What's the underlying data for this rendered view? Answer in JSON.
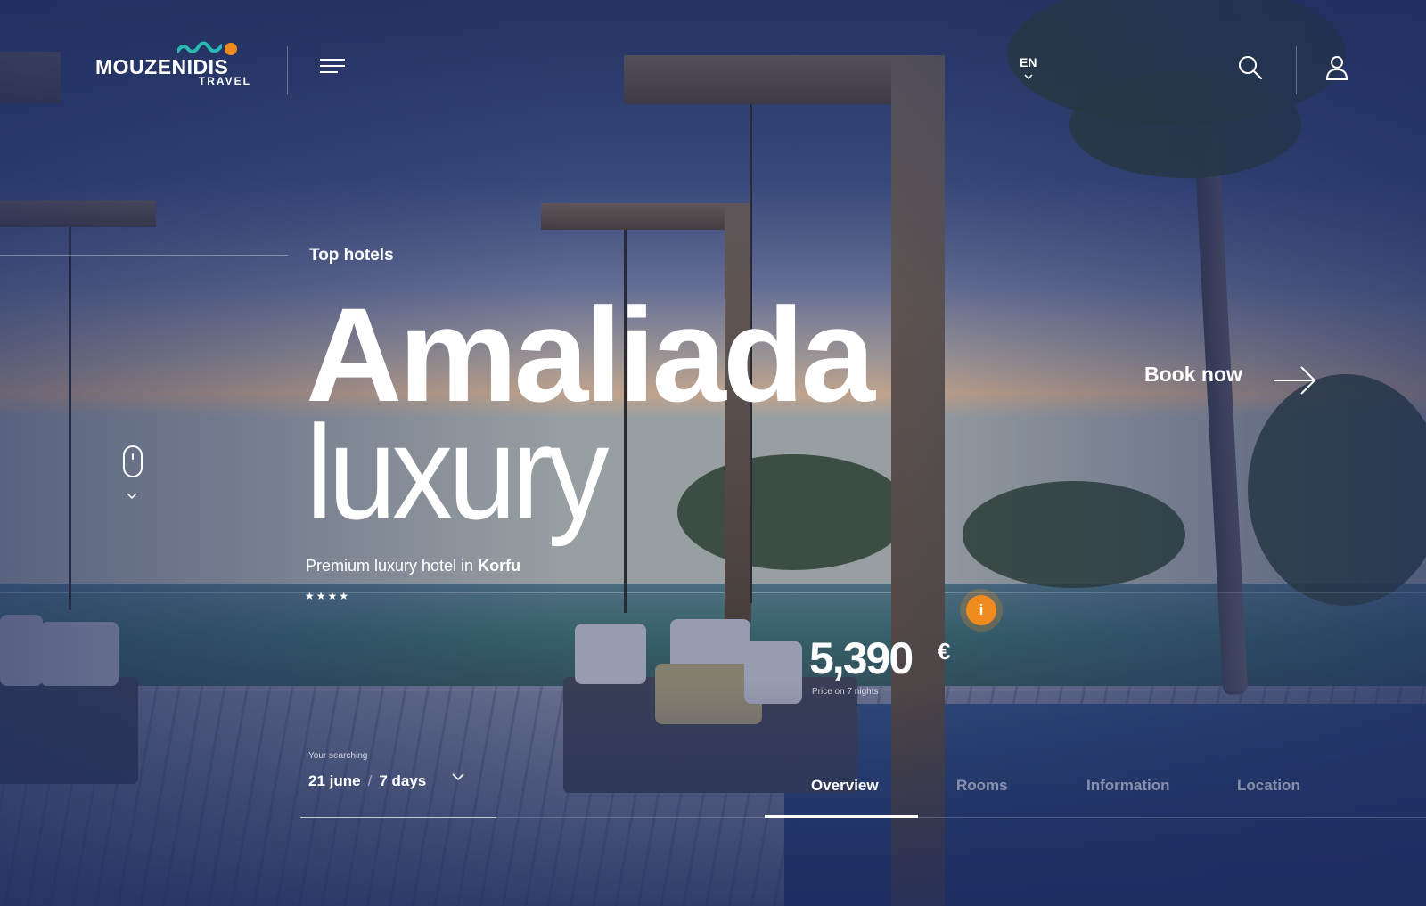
{
  "brand": {
    "name": "MOUZENIDIS",
    "sub": "TRAVEL",
    "accent": "#f08c1e",
    "wave_color": "#2bb8b0"
  },
  "header": {
    "menu_icon": "hamburger-icon",
    "language": "EN",
    "search_icon": "search-icon",
    "user_icon": "user-icon"
  },
  "hero": {
    "kicker": "Top hotels",
    "title": "Amaliada",
    "subtitle": "luxury",
    "tagline_prefix": "Premium luxury hotel in ",
    "tagline_place": "Korfu",
    "stars": "★★★★",
    "star_count": 4
  },
  "cta": {
    "label": "Book now",
    "icon": "arrow-right-icon"
  },
  "price": {
    "amount": "5,390",
    "currency": "€",
    "note": "Price on 7 nights",
    "info_icon": "i"
  },
  "search": {
    "label": "Your searching",
    "date": "21 june",
    "separator": "/",
    "duration": "7 days"
  },
  "tabs": [
    {
      "label": "Overview",
      "active": true
    },
    {
      "label": "Rooms",
      "active": false
    },
    {
      "label": "Information",
      "active": false
    },
    {
      "label": "Location",
      "active": false
    }
  ]
}
